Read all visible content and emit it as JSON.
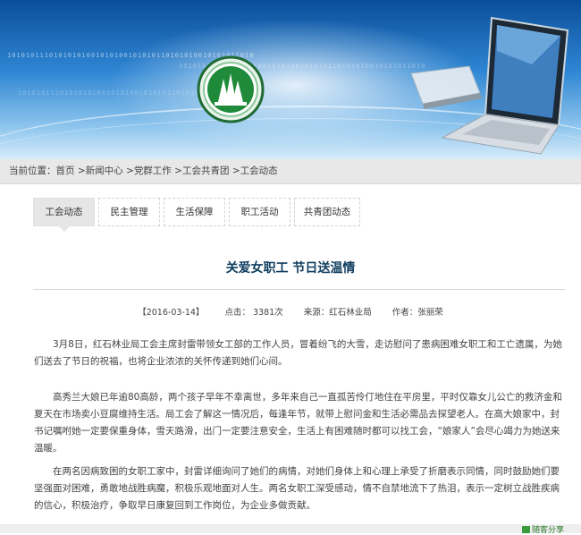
{
  "breadcrumb": {
    "label": "当前位置：",
    "items": [
      "首页",
      "新闻中心",
      "党群工作",
      "工会共青团",
      "工会动态"
    ],
    "separator": ">"
  },
  "tabs": [
    {
      "label": "工会动态",
      "active": true
    },
    {
      "label": "民主管理",
      "active": false
    },
    {
      "label": "生活保障",
      "active": false
    },
    {
      "label": "职工活动",
      "active": false
    },
    {
      "label": "共青团动态",
      "active": false
    }
  ],
  "article": {
    "title": "关爱女职工 节日送温情",
    "date": "【2016-03-14】",
    "hits": "点击： 3381次",
    "source": "来源：红石林业局",
    "author": "作者：张丽荣",
    "paragraphs": [
      "3月8日，红石林业局工会主席封雷带领女工部的工作人员，冒着纷飞的大雪，走访慰问了患病困难女职工和工亡遗属，为她们送去了节日的祝福，也将企业浓浓的关怀传递到她们心间。",
      "高秀兰大娘已年逾80高龄，两个孩子早年不幸离世，多年来自己一直孤苦伶仃地住在平房里，平时仅靠女儿公亡的救济金和夏天在市场卖小豆腐维持生活。局工会了解这一情况后，每逢年节，就带上慰问金和生活必需品去探望老人。在高大娘家中，封书记嘱咐她一定要保重身体，雪天路滑，出门一定要注意安全，生活上有困难随时都可以找工会，“娘家人”会尽心竭力为她送来温暖。",
      "在两名因病致困的女职工家中，封雷详细询问了她们的病情，对她们身体上和心理上承受了折磨表示同情，同时鼓励她们要坚强面对困难，勇敢地战胜病魔，积极乐观地面对人生。两名女职工深受感动，情不自禁地流下了热泪，表示一定树立战胜疾病的信心，积极治疗，争取早日康复回到工作岗位，为企业多做贡献。"
    ]
  },
  "banner": {
    "binary_line": "10101011101010101001010100101010110101010010101011010"
  },
  "share": {
    "label": "随客分享"
  },
  "colors": {
    "title": "#0e3c5e",
    "banner_dark": "#0a4e9a",
    "logo_green": "#1f8a3a"
  }
}
